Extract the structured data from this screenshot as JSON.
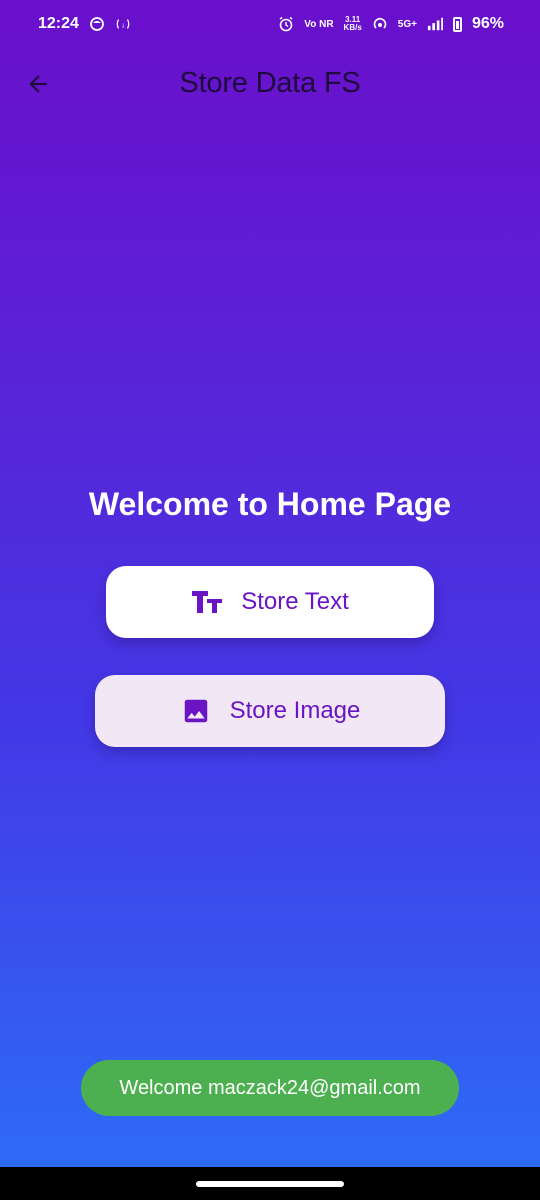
{
  "status_bar": {
    "time": "12:24",
    "net_type": "Vo NR",
    "net_speed_value": "3.11",
    "net_speed_unit": "KB/s",
    "signal_label": "5G+",
    "battery": "96%"
  },
  "app_bar": {
    "title": "Store Data FS",
    "back_icon": "arrow-back-icon"
  },
  "main": {
    "heading": "Welcome to Home Page",
    "buttons": [
      {
        "label": "Store Text",
        "icon": "text-fields-icon"
      },
      {
        "label": "Store Image",
        "icon": "image-icon"
      }
    ]
  },
  "snackbar": {
    "message": "Welcome maczack24@gmail.com"
  },
  "colors": {
    "gradient_top": "#6a0fcb",
    "gradient_bottom": "#2c6ef8",
    "accent": "#6a14c3",
    "snackbar": "#4caf50",
    "title_text": "#1e0b3c"
  }
}
